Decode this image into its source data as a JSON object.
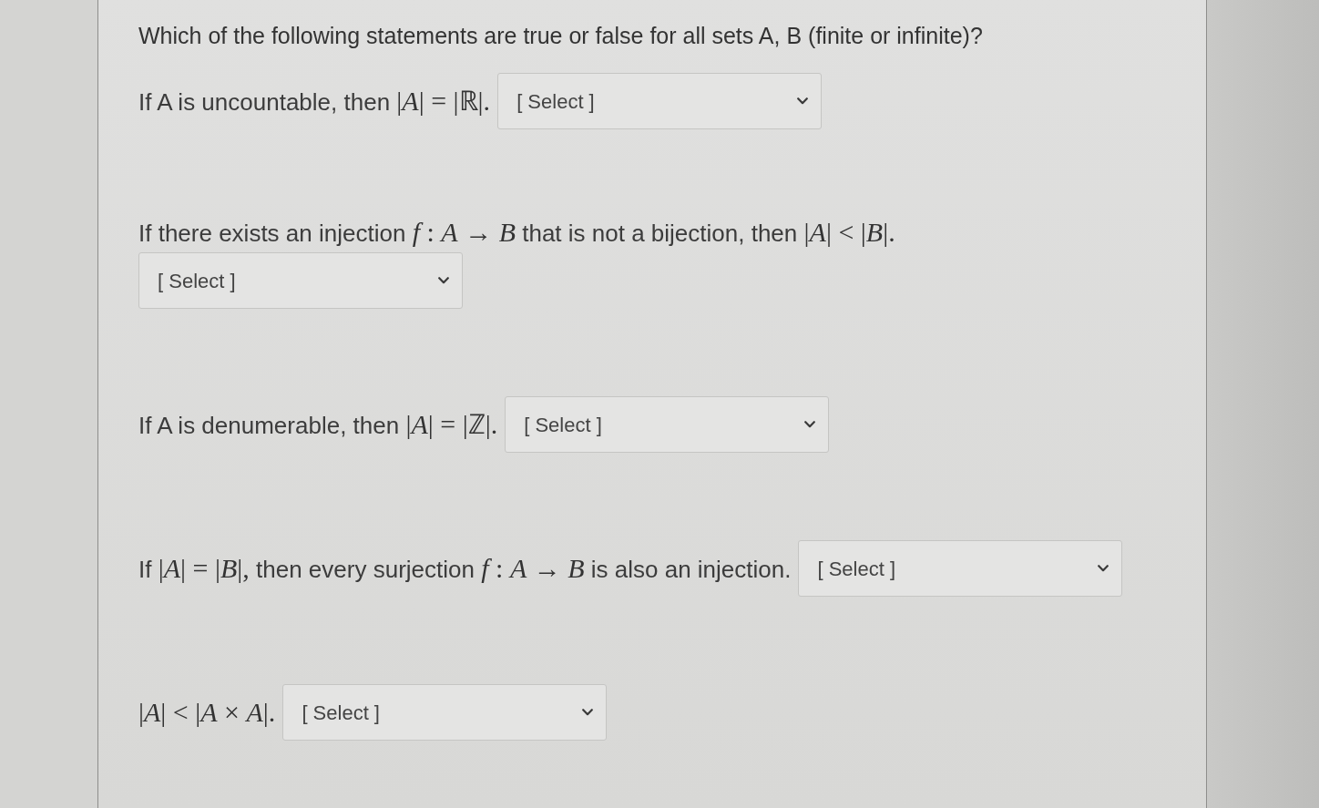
{
  "question": {
    "text": "Which of the following statements are true or false for all sets A, B (finite or infinite)?"
  },
  "items": [
    {
      "kind": "inline",
      "statement": [
        {
          "kind": "text",
          "text": "If A is uncountable, then"
        },
        {
          "kind": "math",
          "text": "|*A*| = |ℝ|."
        }
      ],
      "dropdown": {
        "placeholder": "[ Select ]"
      }
    },
    {
      "kind": "stacked",
      "statement": [
        {
          "kind": "text",
          "text": "If there exists an injection"
        },
        {
          "kind": "math",
          "text": "*f* : *A* → *B*"
        },
        {
          "kind": "text",
          "text": "that is not a bijection, then"
        },
        {
          "kind": "math",
          "text": "|*A*| < |*B*|."
        }
      ],
      "dropdown": {
        "placeholder": "[ Select ]"
      }
    },
    {
      "kind": "inline",
      "statement": [
        {
          "kind": "text",
          "text": "If A is denumerable, then"
        },
        {
          "kind": "math",
          "text": "|*A*| = |ℤ|."
        }
      ],
      "dropdown": {
        "placeholder": "[ Select ]"
      }
    },
    {
      "kind": "inline",
      "statement": [
        {
          "kind": "text",
          "text": "If"
        },
        {
          "kind": "math",
          "text": "|*A*| = |*B*|,"
        },
        {
          "kind": "text",
          "text": "then every surjection"
        },
        {
          "kind": "math",
          "text": "*f* : *A* → *B*"
        },
        {
          "kind": "text",
          "text": "is also an injection."
        }
      ],
      "dropdown": {
        "placeholder": "[ Select ]"
      }
    },
    {
      "kind": "inline",
      "statement": [
        {
          "kind": "math",
          "text": "|*A*| < |*A* × *A*|."
        }
      ],
      "dropdown": {
        "placeholder": "[ Select ]"
      }
    }
  ]
}
